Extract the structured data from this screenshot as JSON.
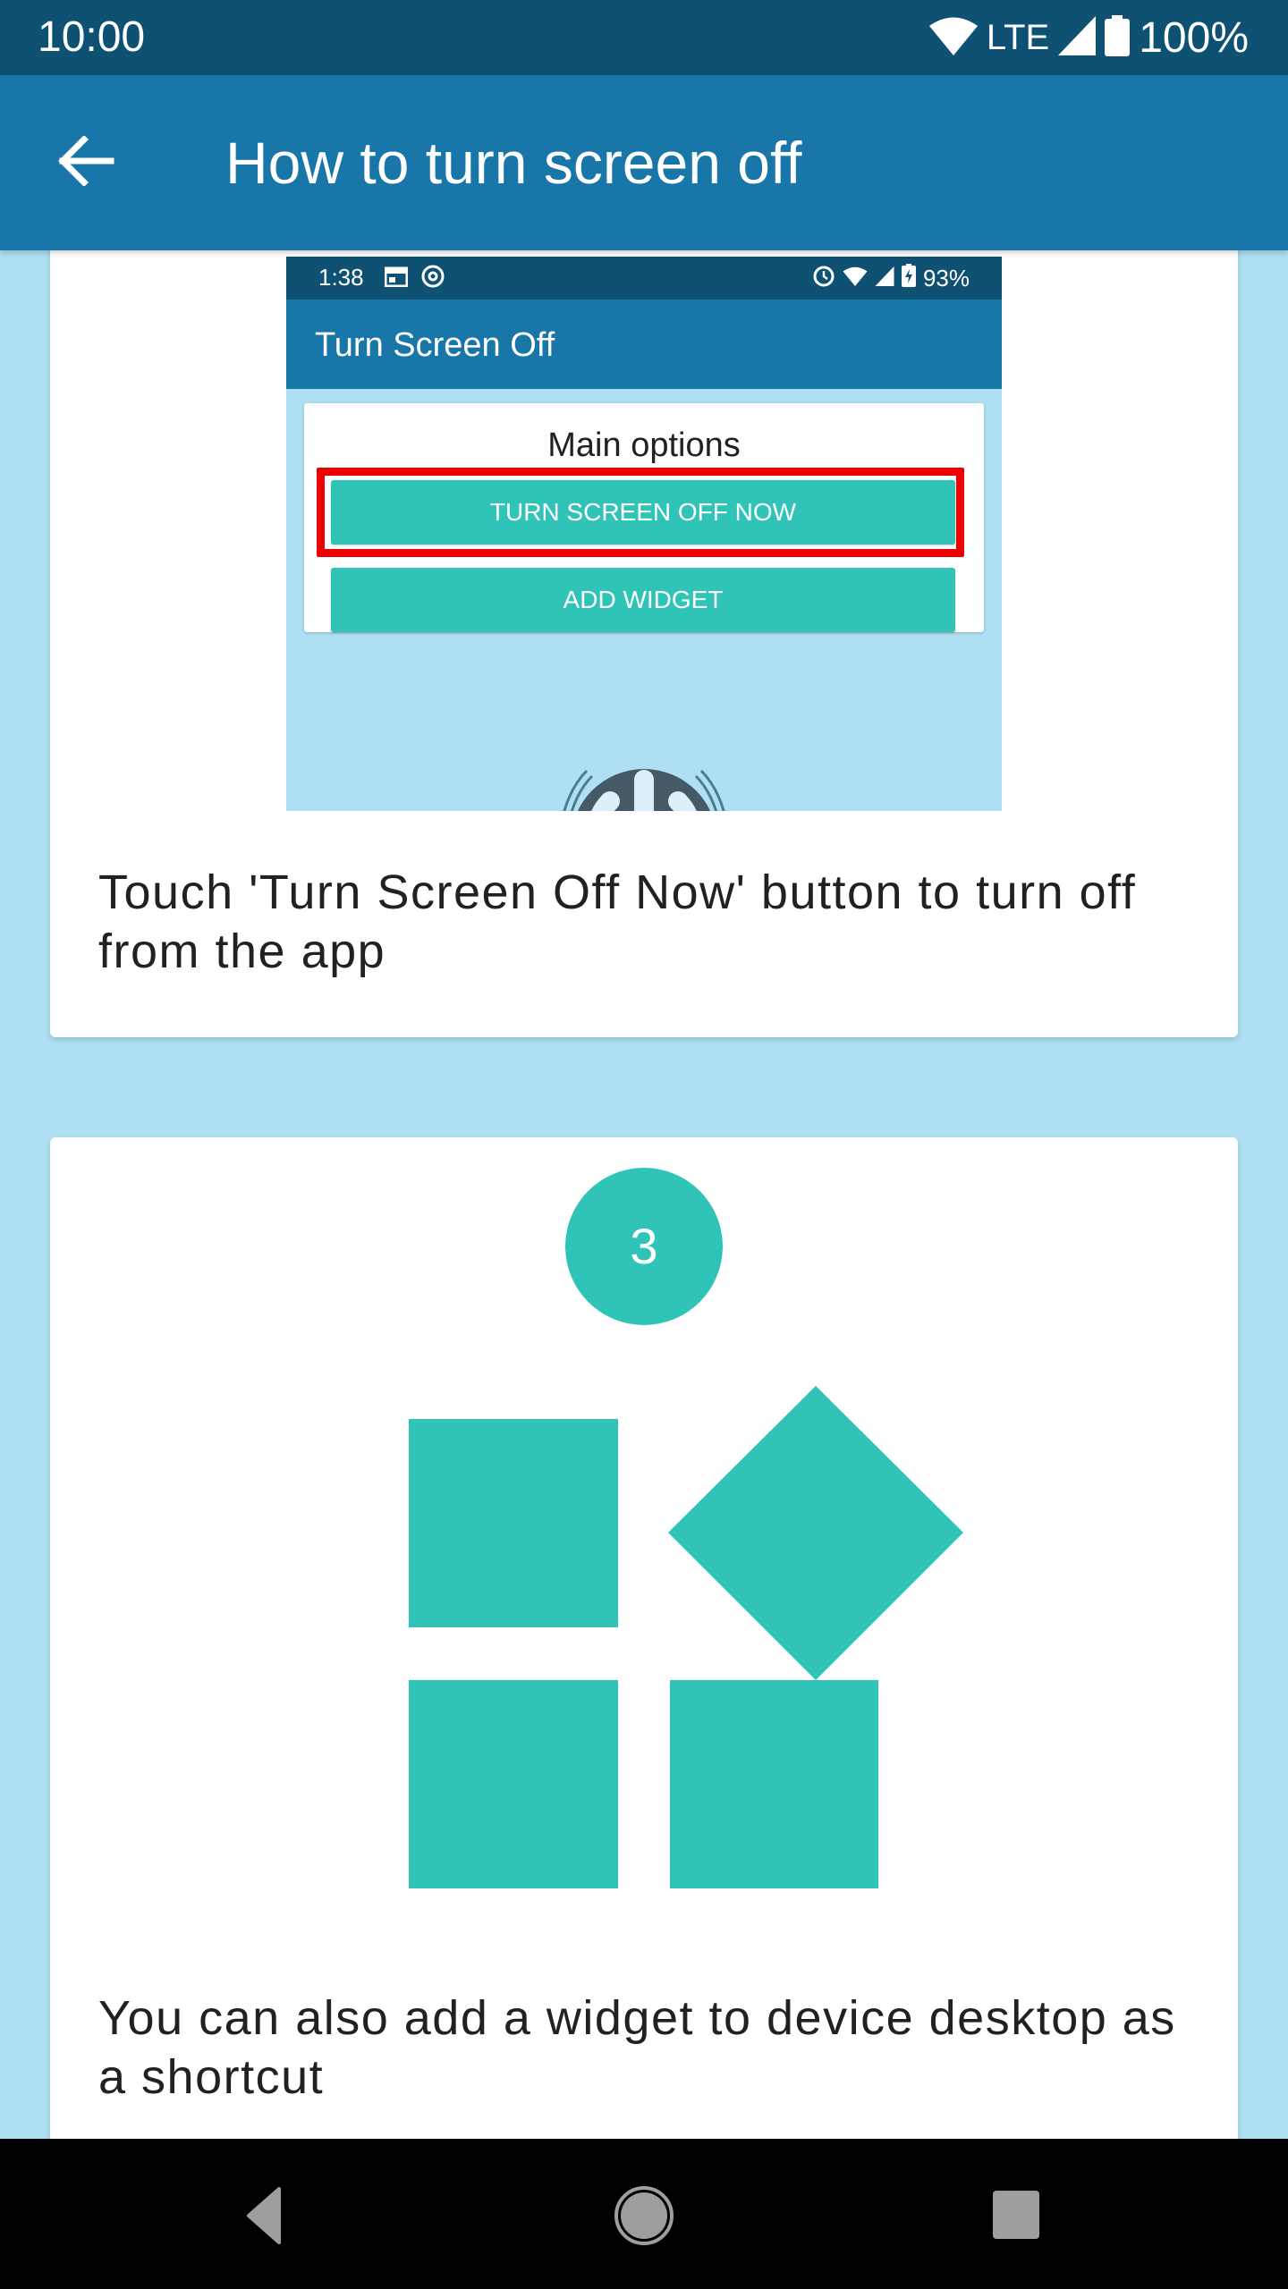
{
  "status_bar": {
    "time": "10:00",
    "network": "LTE",
    "battery": "100%",
    "icons": [
      "wifi-icon",
      "signal-icon",
      "battery-icon"
    ]
  },
  "toolbar": {
    "back_icon": "arrow-back-icon",
    "title": "How to turn screen off"
  },
  "cards": [
    {
      "embedded_screenshot": {
        "status_time": "1:38",
        "status_battery": "93%",
        "app_title": "Turn Screen Off",
        "section_title": "Main options",
        "primary_button": "TURN SCREEN OFF NOW",
        "secondary_button": "ADD WIDGET",
        "highlight_color": "#ee0000"
      },
      "text": "Touch 'Turn Screen Off Now' button to turn off from the app"
    },
    {
      "step_number": "3",
      "icon": "widgets-icon",
      "text": "You can also add a widget to device desktop as a shortcut"
    }
  ],
  "colors": {
    "status_bar": "#0f5172",
    "toolbar": "#1976a8",
    "background": "#aedff3",
    "accent": "#30c4b8"
  },
  "nav_bar": {
    "buttons": [
      "back",
      "home",
      "recents"
    ]
  }
}
